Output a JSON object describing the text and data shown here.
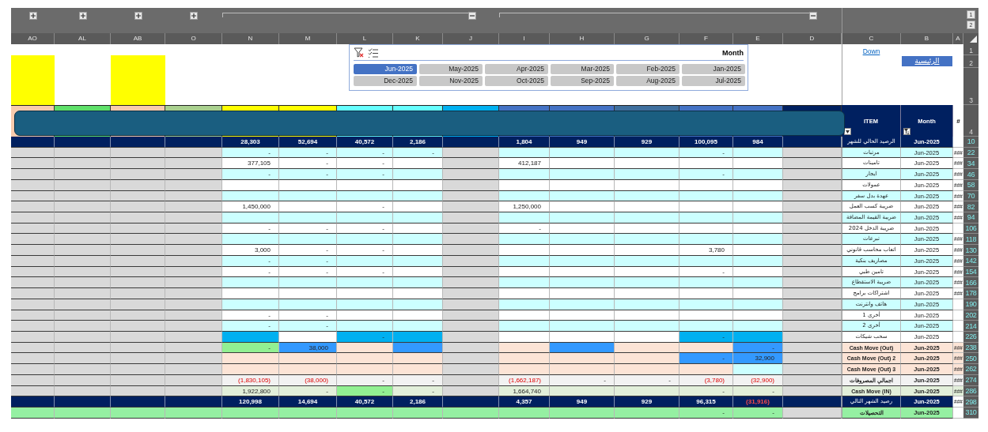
{
  "outline": {
    "groups": [
      {
        "expanded": false
      },
      {
        "expanded": false
      },
      {
        "expanded": false
      },
      {
        "expanded": false
      },
      {
        "expanded": true
      },
      {
        "expanded": true
      }
    ],
    "levels": [
      "1",
      "2"
    ]
  },
  "columns": [
    {
      "letter": "AO",
      "color": "#f8cbad"
    },
    {
      "letter": "AL",
      "color": "#5fe06a"
    },
    {
      "letter": "AB",
      "color": "#f8cbad"
    },
    {
      "letter": "O",
      "color": "#a9d08e"
    },
    {
      "letter": "N",
      "color": "#ffff00"
    },
    {
      "letter": "M",
      "color": "#ffff00"
    },
    {
      "letter": "L",
      "color": "#66ffff"
    },
    {
      "letter": "K",
      "color": "#66ffff"
    },
    {
      "letter": "J",
      "color": "#00b0f0"
    },
    {
      "letter": "I",
      "color": "#4472c4"
    },
    {
      "letter": "H",
      "color": "#4472c4"
    },
    {
      "letter": "G",
      "color": "#3f6f9e"
    },
    {
      "letter": "F",
      "color": "#4472c4"
    },
    {
      "letter": "E",
      "color": "#4472c4"
    },
    {
      "letter": "D",
      "color": "#002060"
    },
    {
      "letter": "C"
    },
    {
      "letter": "B"
    },
    {
      "letter": "A"
    }
  ],
  "top_cells": [
    {
      "color": "#ffff00"
    },
    {},
    {
      "color": "#ffff00"
    },
    {}
  ],
  "top_row_numbers": [
    "1",
    "2",
    "3",
    "4"
  ],
  "link": "Down",
  "home_button": "الرئيسية",
  "slicer": {
    "title": "Month",
    "items": [
      {
        "label": "Jun-2025",
        "selected": true
      },
      {
        "label": "May-2025",
        "selected": false
      },
      {
        "label": "Apr-2025",
        "selected": false
      },
      {
        "label": "Mar-2025",
        "selected": false
      },
      {
        "label": "Feb-2025",
        "selected": false
      },
      {
        "label": "Jan-2025",
        "selected": false
      },
      {
        "label": "Dec-2025",
        "selected": false
      },
      {
        "label": "Nov-2025",
        "selected": false
      },
      {
        "label": "Oct-2025",
        "selected": false
      },
      {
        "label": "Sep-2025",
        "selected": false
      },
      {
        "label": "Aug-2025",
        "selected": false
      },
      {
        "label": "Jul-2025",
        "selected": false
      }
    ]
  },
  "header_row": {
    "item": "ITEM",
    "month": "Month",
    "index": "#"
  },
  "rows": [
    {
      "row": "10",
      "kind": "balance",
      "item": "الرصيد الحالي للشهر",
      "month": "Jun-2025",
      "cells": [
        {},
        {},
        {},
        {},
        {
          "value": "28,303"
        },
        {
          "value": "52,694"
        },
        {
          "value": "40,572"
        },
        {
          "value": "2,186"
        },
        {},
        {
          "value": "1,804"
        },
        {
          "value": "949"
        },
        {
          "value": "929"
        },
        {
          "value": "100,095"
        },
        {
          "value": "984"
        },
        {}
      ]
    },
    {
      "row": "22",
      "kind": "item",
      "item": "مرتبات",
      "month": "Jun-2025",
      "flag": "###",
      "cells": [
        {},
        {},
        {},
        {},
        {
          "value": "-"
        },
        {
          "value": "-"
        },
        {
          "value": "-"
        },
        {
          "value": "-"
        },
        {},
        {},
        {},
        {},
        {
          "value": "-"
        },
        {},
        {}
      ]
    },
    {
      "row": "34",
      "kind": "item",
      "item": "تامينات",
      "month": "Jun-2025",
      "flag": "###",
      "cells": [
        {},
        {},
        {},
        {},
        {
          "value": "377,105"
        },
        {
          "value": "-"
        },
        {
          "value": "-"
        },
        {},
        {},
        {
          "value": "412,187"
        },
        {},
        {},
        {},
        {},
        {}
      ]
    },
    {
      "row": "46",
      "kind": "item",
      "item": "ايجار",
      "month": "Jun-2025",
      "flag": "###",
      "cells": [
        {},
        {},
        {},
        {},
        {
          "value": "-"
        },
        {
          "value": "-"
        },
        {
          "value": "-"
        },
        {},
        {},
        {},
        {},
        {},
        {
          "value": "-"
        },
        {},
        {}
      ]
    },
    {
      "row": "58",
      "kind": "item",
      "item": "عمولات",
      "month": "Jun-2025",
      "flag": "###",
      "cells": [
        {},
        {},
        {},
        {},
        {},
        {},
        {},
        {},
        {},
        {},
        {},
        {},
        {},
        {},
        {}
      ]
    },
    {
      "row": "70",
      "kind": "item",
      "item": "عهدة بدل سفر",
      "month": "Jun-2025",
      "flag": "###",
      "cells": [
        {},
        {},
        {},
        {},
        {},
        {},
        {},
        {},
        {},
        {},
        {},
        {},
        {},
        {},
        {}
      ]
    },
    {
      "row": "82",
      "kind": "item",
      "item": "ضريبة كسب العمل",
      "month": "Jun-2025",
      "flag": "###",
      "cells": [
        {},
        {},
        {},
        {},
        {
          "value": "1,450,000"
        },
        {},
        {
          "value": "-"
        },
        {},
        {},
        {
          "value": "1,250,000"
        },
        {},
        {},
        {},
        {},
        {}
      ]
    },
    {
      "row": "94",
      "kind": "item",
      "item": "ضريبة القيمة المضافة",
      "month": "Jun-2025",
      "flag": "###",
      "cells": [
        {},
        {},
        {},
        {},
        {},
        {},
        {},
        {},
        {},
        {},
        {},
        {},
        {},
        {},
        {}
      ]
    },
    {
      "row": "106",
      "kind": "item",
      "item": "ضريبة الدخل 2024",
      "month": "Jun-2025",
      "cells": [
        {},
        {},
        {},
        {},
        {
          "value": "-"
        },
        {
          "value": "-"
        },
        {
          "value": "-"
        },
        {},
        {},
        {
          "value": "-"
        },
        {},
        {},
        {},
        {},
        {}
      ]
    },
    {
      "row": "118",
      "kind": "item",
      "item": "تبرعات",
      "month": "Jun-2025",
      "flag": "###",
      "cells": [
        {},
        {},
        {},
        {},
        {},
        {},
        {},
        {},
        {},
        {},
        {},
        {},
        {},
        {},
        {}
      ]
    },
    {
      "row": "130",
      "kind": "item",
      "item": "اتعاب محاسب قانوني",
      "month": "Jun-2025",
      "flag": "###",
      "cells": [
        {},
        {},
        {},
        {},
        {
          "value": "3,000"
        },
        {
          "value": "-"
        },
        {
          "value": "-"
        },
        {},
        {},
        {},
        {},
        {},
        {
          "value": "3,780"
        },
        {},
        {}
      ]
    },
    {
      "row": "142",
      "kind": "item",
      "item": "مصاريف بنكية",
      "month": "Jun-2025",
      "flag": "###",
      "cells": [
        {},
        {},
        {},
        {},
        {
          "value": "-"
        },
        {
          "value": "-"
        },
        {},
        {},
        {},
        {},
        {},
        {},
        {},
        {},
        {}
      ]
    },
    {
      "row": "154",
      "kind": "item",
      "item": "تامين طبي",
      "month": "Jun-2025",
      "flag": "###",
      "cells": [
        {},
        {},
        {},
        {},
        {
          "value": "-"
        },
        {
          "value": "-"
        },
        {
          "value": "-"
        },
        {},
        {},
        {},
        {},
        {},
        {
          "value": "-"
        },
        {},
        {}
      ]
    },
    {
      "row": "166",
      "kind": "item",
      "item": "ضريبة الاستقطاع",
      "month": "Jun-2025",
      "flag": "###",
      "cells": [
        {},
        {},
        {},
        {},
        {},
        {},
        {},
        {},
        {},
        {},
        {},
        {},
        {},
        {},
        {}
      ]
    },
    {
      "row": "178",
      "kind": "item",
      "item": "اشتراكات برامج",
      "month": "Jun-2025",
      "flag": "###",
      "cells": [
        {},
        {},
        {},
        {},
        {},
        {},
        {},
        {},
        {},
        {},
        {},
        {},
        {},
        {},
        {}
      ]
    },
    {
      "row": "190",
      "kind": "item",
      "item": "هاتف وانترنت",
      "month": "Jun-2025",
      "cells": [
        {},
        {},
        {},
        {},
        {},
        {},
        {},
        {},
        {},
        {},
        {},
        {},
        {},
        {},
        {}
      ]
    },
    {
      "row": "202",
      "kind": "item",
      "item": "أخرى 1",
      "month": "Jun-2025",
      "cells": [
        {},
        {},
        {},
        {},
        {
          "value": "-"
        },
        {
          "value": "-"
        },
        {},
        {},
        {},
        {},
        {},
        {},
        {},
        {},
        {}
      ]
    },
    {
      "row": "214",
      "kind": "item",
      "item": "أخرى 2",
      "month": "Jun-2025",
      "cells": [
        {},
        {},
        {},
        {},
        {
          "value": "-"
        },
        {
          "value": "-"
        },
        {},
        {},
        {},
        {},
        {},
        {},
        {},
        {},
        {}
      ]
    },
    {
      "row": "226",
      "kind": "item",
      "item": "سحب شيكات",
      "month": "Jun-2025",
      "cells": [
        {},
        {},
        {},
        {},
        {
          "color": "#00b0f0"
        },
        {},
        {
          "value": "-",
          "color": "#00b0f0"
        },
        {
          "color": "#00b0f0"
        },
        {},
        {},
        {},
        {},
        {
          "value": "-",
          "color": "#00b0f0"
        },
        {
          "color": "#00b0f0"
        },
        {}
      ]
    },
    {
      "row": "238",
      "kind": "cash-out",
      "item": "Cash Move (Out)",
      "month": "Jun-2025",
      "flag": "###",
      "cells": [
        {},
        {},
        {},
        {},
        {
          "value": "-",
          "color": "#92f092"
        },
        {
          "value": "38,000",
          "color": "#3399ff"
        },
        {},
        {
          "color": "#3399ff"
        },
        {},
        {},
        {
          "color": "#3399ff"
        },
        {},
        {},
        {
          "value": "-",
          "color": "#3399ff"
        },
        {}
      ]
    },
    {
      "row": "250",
      "kind": "cash-out",
      "item": "Cash Move (Out) 2",
      "month": "Jun-2025",
      "flag": "###",
      "cells": [
        {},
        {},
        {},
        {},
        {},
        {},
        {},
        {},
        {},
        {},
        {},
        {},
        {
          "value": "-",
          "color": "#3399ff"
        },
        {
          "value": "32,900",
          "color": "#3399ff"
        },
        {}
      ]
    },
    {
      "row": "262",
      "kind": "cash-out",
      "item": "Cash Move (Out) 3",
      "month": "Jun-2025",
      "flag": "###",
      "cells": [
        {},
        {},
        {},
        {},
        {},
        {},
        {},
        {},
        {},
        {},
        {},
        {},
        {},
        {
          "color": "#ccffff"
        },
        {}
      ]
    },
    {
      "row": "274",
      "kind": "total",
      "item": "اجمالي المصروفات",
      "month": "Jun-2025",
      "flag": "###",
      "cells": [
        {},
        {},
        {},
        {},
        {
          "value": "(1,830,105)",
          "negative": true
        },
        {
          "value": "(38,000)",
          "negative": true
        },
        {
          "value": "-"
        },
        {
          "value": "-"
        },
        {},
        {
          "value": "(1,662,187)",
          "negative": true
        },
        {
          "value": "-"
        },
        {
          "value": "-"
        },
        {
          "value": "(3,780)",
          "negative": true
        },
        {
          "value": "(32,900)",
          "negative": true
        },
        {}
      ]
    },
    {
      "row": "286",
      "kind": "cash-in",
      "item": "Cash Move (IN)",
      "month": "Jun-2025",
      "flag": "###",
      "cells": [
        {},
        {},
        {},
        {},
        {
          "value": "1,922,800"
        },
        {
          "value": "-"
        },
        {
          "value": "-",
          "color": "#92f092"
        },
        {
          "value": "-"
        },
        {},
        {
          "value": "1,664,740"
        },
        {},
        {},
        {
          "value": "-"
        },
        {
          "value": "-"
        },
        {}
      ]
    },
    {
      "row": "298",
      "kind": "next-balance",
      "item": "رصيد الشهر التالي",
      "month": "Jun-2025",
      "flag": "###",
      "cells": [
        {},
        {},
        {},
        {},
        {
          "value": "120,998"
        },
        {
          "value": "14,694"
        },
        {
          "value": "40,572"
        },
        {
          "value": "2,186"
        },
        {},
        {
          "value": "4,357"
        },
        {
          "value": "949"
        },
        {
          "value": "929"
        },
        {
          "value": "96,315"
        },
        {
          "value": "(31,916)",
          "negative": true
        },
        {}
      ]
    },
    {
      "row": "310",
      "kind": "collections",
      "item": "التحصيلات",
      "month": "Jun-2025",
      "cells": [
        {},
        {},
        {},
        {},
        {},
        {},
        {},
        {},
        {},
        {},
        {},
        {},
        {
          "value": "-"
        },
        {
          "value": "-"
        },
        {}
      ]
    }
  ]
}
